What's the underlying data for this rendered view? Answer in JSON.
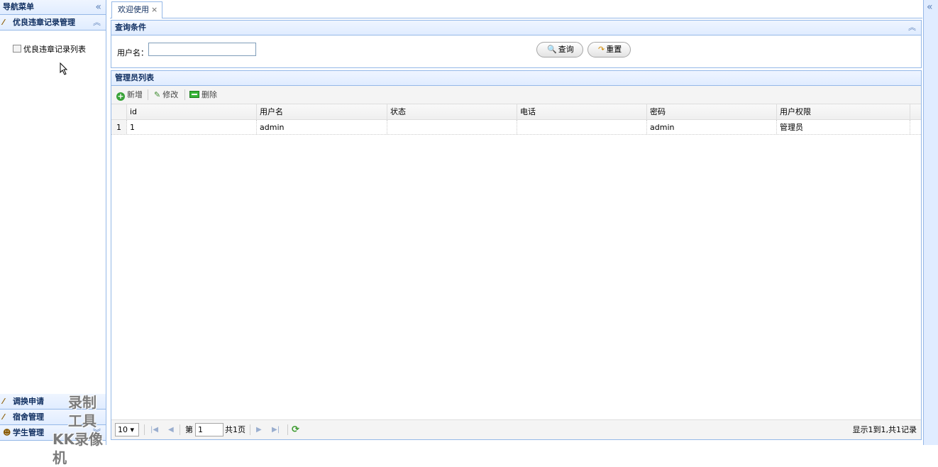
{
  "nav": {
    "title": "导航菜单",
    "sections": [
      {
        "label": "优良违章记录管理",
        "expanded": true,
        "items": [
          "优良违章记录列表"
        ]
      },
      {
        "label": "调换申请",
        "expanded": false
      },
      {
        "label": "宿舍管理",
        "expanded": false
      },
      {
        "label": "学生管理",
        "expanded": false
      }
    ]
  },
  "watermark": {
    "line1": "录制工具",
    "line2": "KK录像机"
  },
  "tabs": [
    {
      "label": "欢迎使用",
      "close": "×"
    }
  ],
  "query": {
    "title": "查询条件",
    "username_label": "用户名：",
    "username_value": "",
    "search_label": "查询",
    "reset_label": "重置"
  },
  "list": {
    "title": "管理员列表",
    "toolbar": {
      "add": "新增",
      "edit": "修改",
      "delete": "删除"
    },
    "columns": [
      "id",
      "用户名",
      "状态",
      "电话",
      "密码",
      "用户权限"
    ],
    "rows": [
      {
        "num": "1",
        "id": "1",
        "username": "admin",
        "status": "",
        "phone": "",
        "password": "admin",
        "role": "管理员"
      }
    ]
  },
  "pager": {
    "page_size": "10",
    "page_prefix": "第",
    "page_value": "1",
    "page_total": "共1页",
    "summary": "显示1到1,共1记录"
  },
  "colors": {
    "border": "#95b8e7",
    "header_bg": "#e0ecff",
    "header_text": "#0e2d5f"
  }
}
